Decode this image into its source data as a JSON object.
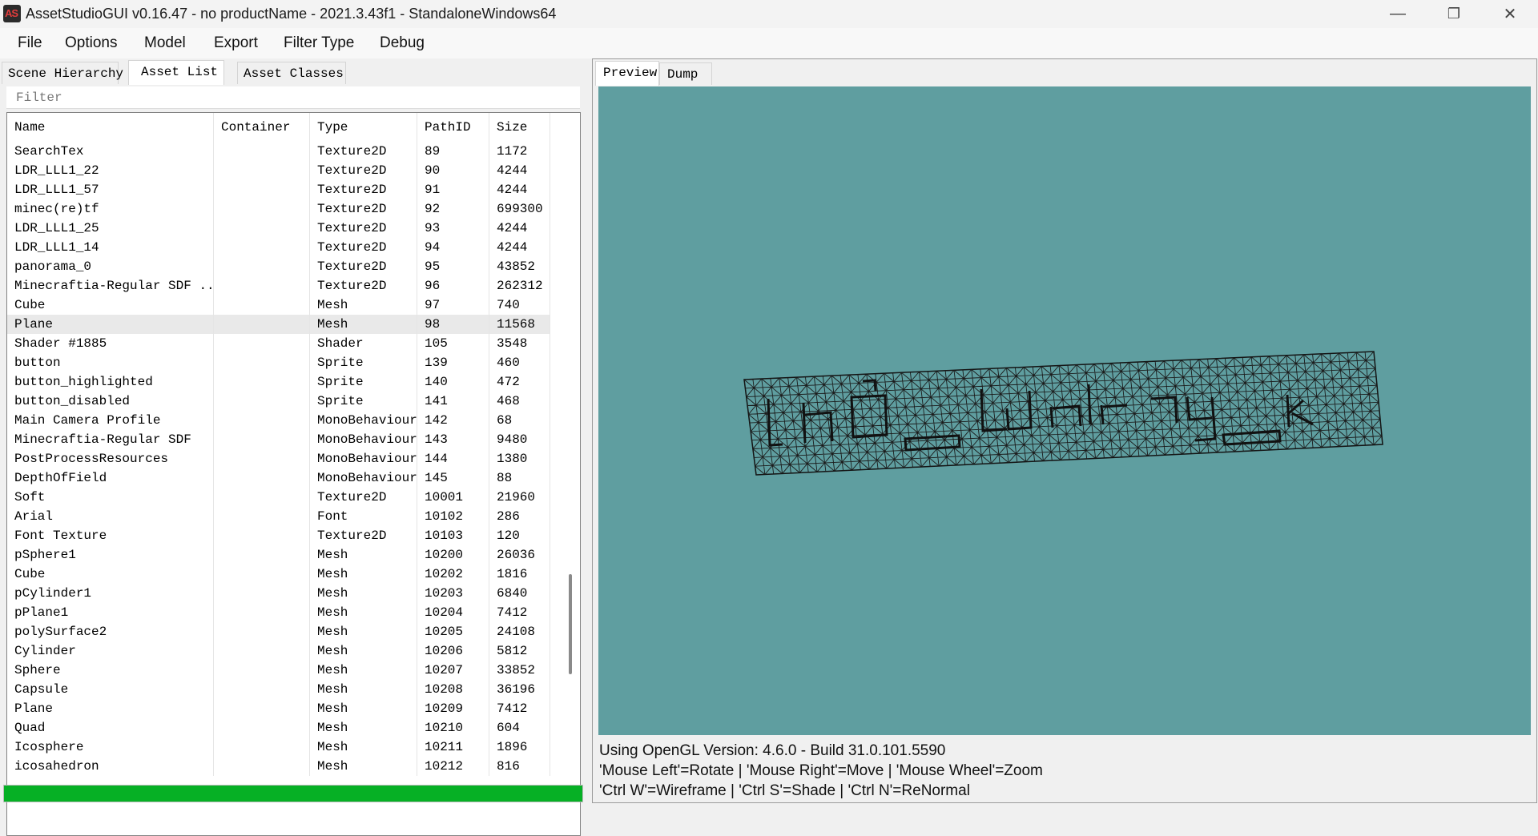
{
  "window": {
    "app_icon_text": "AS",
    "title": "AssetStudioGUI v0.16.47 - no productName - 2021.3.43f1 - StandaloneWindows64",
    "minimize_glyph": "—",
    "maximize_glyph": "❐",
    "close_glyph": "✕"
  },
  "menu": {
    "items": [
      {
        "label": "File"
      },
      {
        "label": "Options"
      },
      {
        "label": "Model"
      },
      {
        "label": "Export"
      },
      {
        "label": "Filter Type"
      },
      {
        "label": "Debug"
      }
    ]
  },
  "left_tabs": {
    "items": [
      {
        "label": "Scene Hierarchy"
      },
      {
        "label": "Asset List"
      },
      {
        "label": "Asset Classes"
      }
    ],
    "active": "Asset List"
  },
  "filter": {
    "placeholder": "Filter",
    "value": ""
  },
  "asset_list": {
    "columns": [
      {
        "label": "Name"
      },
      {
        "label": "Container"
      },
      {
        "label": "Type"
      },
      {
        "label": "PathID"
      },
      {
        "label": "Size"
      }
    ],
    "rows": [
      {
        "name": "SearchTex",
        "container": "",
        "type": "Texture2D",
        "pathid": "89",
        "size": "1172"
      },
      {
        "name": "LDR_LLL1_22",
        "container": "",
        "type": "Texture2D",
        "pathid": "90",
        "size": "4244"
      },
      {
        "name": "LDR_LLL1_57",
        "container": "",
        "type": "Texture2D",
        "pathid": "91",
        "size": "4244"
      },
      {
        "name": "minec(re)tf",
        "container": "",
        "type": "Texture2D",
        "pathid": "92",
        "size": "699300"
      },
      {
        "name": "LDR_LLL1_25",
        "container": "",
        "type": "Texture2D",
        "pathid": "93",
        "size": "4244"
      },
      {
        "name": "LDR_LLL1_14",
        "container": "",
        "type": "Texture2D",
        "pathid": "94",
        "size": "4244"
      },
      {
        "name": "panorama_0",
        "container": "",
        "type": "Texture2D",
        "pathid": "95",
        "size": "43852"
      },
      {
        "name": "Minecraftia-Regular SDF ...",
        "container": "",
        "type": "Texture2D",
        "pathid": "96",
        "size": "262312"
      },
      {
        "name": "Cube",
        "container": "",
        "type": "Mesh",
        "pathid": "97",
        "size": "740"
      },
      {
        "name": "Plane",
        "container": "",
        "type": "Mesh",
        "pathid": "98",
        "size": "11568",
        "selected": true
      },
      {
        "name": "Shader #1885",
        "container": "",
        "type": "Shader",
        "pathid": "105",
        "size": "3548"
      },
      {
        "name": "button",
        "container": "",
        "type": "Sprite",
        "pathid": "139",
        "size": "460"
      },
      {
        "name": "button_highlighted",
        "container": "",
        "type": "Sprite",
        "pathid": "140",
        "size": "472"
      },
      {
        "name": "button_disabled",
        "container": "",
        "type": "Sprite",
        "pathid": "141",
        "size": "468"
      },
      {
        "name": "Main Camera Profile",
        "container": "",
        "type": "MonoBehaviour",
        "pathid": "142",
        "size": "68"
      },
      {
        "name": "Minecraftia-Regular SDF",
        "container": "",
        "type": "MonoBehaviour",
        "pathid": "143",
        "size": "9480"
      },
      {
        "name": "PostProcessResources",
        "container": "",
        "type": "MonoBehaviour",
        "pathid": "144",
        "size": "1380"
      },
      {
        "name": "DepthOfField",
        "container": "",
        "type": "MonoBehaviour",
        "pathid": "145",
        "size": "88"
      },
      {
        "name": "Soft",
        "container": "",
        "type": "Texture2D",
        "pathid": "10001",
        "size": "21960"
      },
      {
        "name": "Arial",
        "container": "",
        "type": "Font",
        "pathid": "10102",
        "size": "286"
      },
      {
        "name": "Font Texture",
        "container": "",
        "type": "Texture2D",
        "pathid": "10103",
        "size": "120"
      },
      {
        "name": "pSphere1",
        "container": "",
        "type": "Mesh",
        "pathid": "10200",
        "size": "26036"
      },
      {
        "name": "Cube",
        "container": "",
        "type": "Mesh",
        "pathid": "10202",
        "size": "1816"
      },
      {
        "name": "pCylinder1",
        "container": "",
        "type": "Mesh",
        "pathid": "10203",
        "size": "6840"
      },
      {
        "name": "pPlane1",
        "container": "",
        "type": "Mesh",
        "pathid": "10204",
        "size": "7412"
      },
      {
        "name": "polySurface2",
        "container": "",
        "type": "Mesh",
        "pathid": "10205",
        "size": "24108"
      },
      {
        "name": "Cylinder",
        "container": "",
        "type": "Mesh",
        "pathid": "10206",
        "size": "5812"
      },
      {
        "name": "Sphere",
        "container": "",
        "type": "Mesh",
        "pathid": "10207",
        "size": "33852"
      },
      {
        "name": "Capsule",
        "container": "",
        "type": "Mesh",
        "pathid": "10208",
        "size": "36196"
      },
      {
        "name": "Plane",
        "container": "",
        "type": "Mesh",
        "pathid": "10209",
        "size": "7412"
      },
      {
        "name": "Quad",
        "container": "",
        "type": "Mesh",
        "pathid": "10210",
        "size": "604"
      },
      {
        "name": "Icosphere",
        "container": "",
        "type": "Mesh",
        "pathid": "10211",
        "size": "1896"
      },
      {
        "name": "icosahedron",
        "container": "",
        "type": "Mesh",
        "pathid": "10212",
        "size": "816"
      }
    ]
  },
  "progress": {
    "value": 1.0,
    "color": "#06b025"
  },
  "right_tabs": {
    "items": [
      {
        "label": "Preview"
      },
      {
        "label": "Dump"
      }
    ],
    "active": "Preview"
  },
  "preview": {
    "background_color": "#5f9ea0",
    "mesh_mode": "wireframe"
  },
  "status": {
    "line1": "Using OpenGL Version: 4.6.0 - Build 31.0.101.5590",
    "line2": "'Mouse Left'=Rotate | 'Mouse Right'=Move | 'Mouse Wheel'=Zoom",
    "line3": "'Ctrl W'=Wireframe | 'Ctrl S'=Shade | 'Ctrl N'=ReNormal"
  }
}
